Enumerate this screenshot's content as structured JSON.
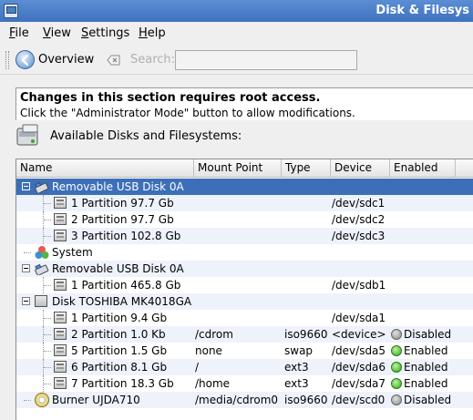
{
  "window": {
    "title": "Disk & Filesys"
  },
  "menu": [
    {
      "label": "File",
      "access": "F",
      "rest": "ile"
    },
    {
      "label": "View",
      "access": "V",
      "rest": "iew"
    },
    {
      "label": "Settings",
      "access": "S",
      "rest": "ettings"
    },
    {
      "label": "Help",
      "access": "H",
      "rest": "elp"
    }
  ],
  "toolbar": {
    "overview_label": "Overview",
    "search_label": "Search:",
    "search_value": ""
  },
  "notice": {
    "title": "Changes in this section requires root access.",
    "body": "Click the \"Administrator Mode\" button to allow modifications."
  },
  "section": {
    "label": "Available Disks and Filesystems:"
  },
  "columns": [
    "Name",
    "Mount Point",
    "Type",
    "Device",
    "Enabled"
  ],
  "rows": [
    {
      "name": "Removable USB Disk 0A",
      "mount": "",
      "type": "",
      "device": "",
      "enabled": "",
      "status": "",
      "level": 0,
      "icon": "usb-drive-icon",
      "expander": true,
      "selected": true
    },
    {
      "name": "1 Partition 97.7 Gb",
      "mount": "",
      "type": "",
      "device": "/dev/sdc1",
      "enabled": "",
      "status": "",
      "level": 1,
      "icon": "partition-icon"
    },
    {
      "name": "2 Partition 97.7 Gb",
      "mount": "",
      "type": "",
      "device": "/dev/sdc2",
      "enabled": "",
      "status": "",
      "level": 1,
      "icon": "partition-icon"
    },
    {
      "name": "3 Partition 102.8 Gb",
      "mount": "",
      "type": "",
      "device": "/dev/sdc3",
      "enabled": "",
      "status": "",
      "level": 1,
      "icon": "partition-icon"
    },
    {
      "name": "System",
      "mount": "",
      "type": "",
      "device": "",
      "enabled": "",
      "status": "",
      "level": 0,
      "icon": "system-icon"
    },
    {
      "name": "Removable USB Disk 0A",
      "mount": "",
      "type": "",
      "device": "",
      "enabled": "",
      "status": "",
      "level": 0,
      "icon": "usb-drive-icon",
      "expander": true
    },
    {
      "name": "1 Partition 465.8 Gb",
      "mount": "",
      "type": "",
      "device": "/dev/sdb1",
      "enabled": "",
      "status": "",
      "level": 1,
      "icon": "partition-icon"
    },
    {
      "name": "Disk TOSHIBA MK4018GA",
      "mount": "",
      "type": "",
      "device": "",
      "enabled": "",
      "status": "",
      "level": 0,
      "icon": "hard-disk-icon",
      "expander": true
    },
    {
      "name": "1 Partition 9.4 Gb",
      "mount": "",
      "type": "",
      "device": "/dev/sda1",
      "enabled": "",
      "status": "",
      "level": 1,
      "icon": "partition-icon"
    },
    {
      "name": "2 Partition 1.0 Kb",
      "mount": "/cdrom",
      "type": "iso9660",
      "device": "<device>",
      "enabled": "Disabled",
      "status": "grey",
      "level": 1,
      "icon": "partition-icon"
    },
    {
      "name": "5 Partition 1.5 Gb",
      "mount": "none",
      "type": "swap",
      "device": "/dev/sda5",
      "enabled": "Enabled",
      "status": "green",
      "level": 1,
      "icon": "partition-icon"
    },
    {
      "name": "6 Partition 8.1 Gb",
      "mount": "/",
      "type": "ext3",
      "device": "/dev/sda6",
      "enabled": "Enabled",
      "status": "green",
      "level": 1,
      "icon": "partition-icon"
    },
    {
      "name": "7 Partition 18.3 Gb",
      "mount": "/home",
      "type": "ext3",
      "device": "/dev/sda7",
      "enabled": "Enabled",
      "status": "green",
      "level": 1,
      "icon": "partition-icon"
    },
    {
      "name": "Burner UJDA710",
      "mount": "/media/cdrom0",
      "type": "iso9660",
      "device": "/dev/scd0",
      "enabled": "Disabled",
      "status": "grey",
      "level": 0,
      "icon": "cd-burner-icon"
    }
  ],
  "colors": {
    "selection": "#3c6fb8",
    "title_bar": "#3e72bf",
    "enabled": "#34a31d",
    "disabled": "#8a8a8a"
  }
}
